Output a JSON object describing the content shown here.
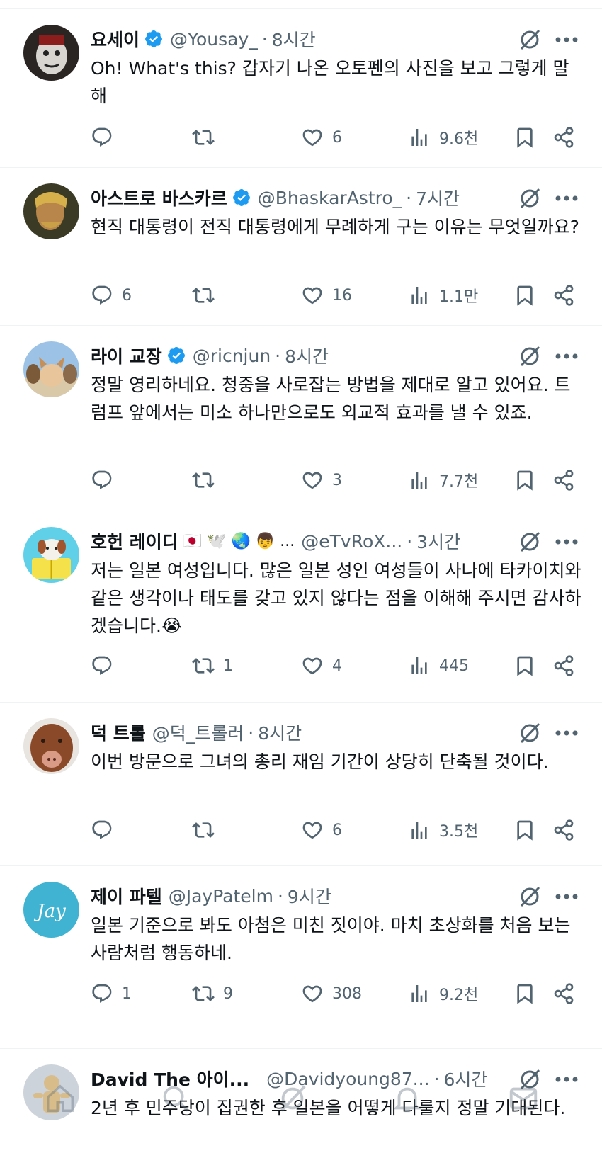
{
  "tweets": [
    {
      "name": "요세이",
      "verified": true,
      "emojis": "",
      "handle": "@Yousay_",
      "sep": "·",
      "time": "8시간",
      "text": "Oh! What's this? 갑자기 나온 오토펜의 사진을 보고 그렇게 말해",
      "replies": "",
      "retweets": "",
      "likes": "6",
      "views": "9.6천"
    },
    {
      "name": "아스트로 바스카르",
      "verified": true,
      "emojis": "",
      "handle": "@BhaskarAstro_",
      "sep": "·",
      "time": "7시간",
      "text": "현직 대통령이 전직 대통령에게 무례하게 구는 이유는 무엇일까요?",
      "replies": "6",
      "retweets": "",
      "likes": "16",
      "views": "1.1만"
    },
    {
      "name": "라이 교장",
      "verified": true,
      "emojis": "",
      "handle": "@ricnjun",
      "sep": "·",
      "time": "8시간",
      "text": "정말 영리하네요. 청중을 사로잡는 방법을 제대로 알고 있어요. 트럼프 앞에서는 미소 하나만으로도 외교적 효과를 낼 수 있죠.",
      "replies": "",
      "retweets": "",
      "likes": "3",
      "views": "7.7천"
    },
    {
      "name": "호헌 레이디",
      "verified": false,
      "emojis": "🇯🇵 🕊️ 🌏 👦 ...",
      "handle": "@eTvRoX...",
      "sep": "·",
      "time": "3시간",
      "text": "저는 일본 여성입니다. 많은 일본 성인 여성들이 사나에 타카이치와 같은 생각이나 태도를 갖고 있지 않다는 점을 이해해 주시면 감사하겠습니다.😭",
      "replies": "",
      "retweets": "1",
      "likes": "4",
      "views": "445"
    },
    {
      "name": "덕 트롤",
      "verified": false,
      "emojis": "",
      "handle": "@덕_트롤러",
      "sep": "·",
      "time": "8시간",
      "text": "이번 방문으로 그녀의 총리 재임 기간이 상당히 단축될 것이다.",
      "replies": "",
      "retweets": "",
      "likes": "6",
      "views": "3.5천"
    },
    {
      "name": "제이 파텔",
      "verified": false,
      "emojis": "",
      "handle": "@JayPatelm",
      "sep": "·",
      "time": "9시간",
      "text": "일본 기준으로 봐도 아첨은 미친 짓이야. 마치 초상화를 처음 보는 사람처럼 행동하네.",
      "replies": "1",
      "retweets": "9",
      "likes": "308",
      "views": "9.2천"
    },
    {
      "name": "David The 아이...",
      "verified": false,
      "emojis": "",
      "handle": "@Davidyoung87...",
      "sep": "·",
      "time": "6시간",
      "text": "2년 후 민주당이 집권한 후 일본을 어떻게 다룰지 정말 기대된다.",
      "replies": "",
      "retweets": "",
      "likes": "",
      "views": ""
    }
  ],
  "icons": {
    "reply": "reply-icon",
    "retweet": "retweet-icon",
    "like": "heart-icon",
    "views": "views-icon",
    "bookmark": "bookmark-icon",
    "share": "share-icon",
    "grok": "grok-icon",
    "more": "more-icon"
  },
  "colors": {
    "verified": "#1d9bf0",
    "secondary_text": "#536471",
    "text": "#0f1419",
    "divider": "#eff3f4"
  }
}
